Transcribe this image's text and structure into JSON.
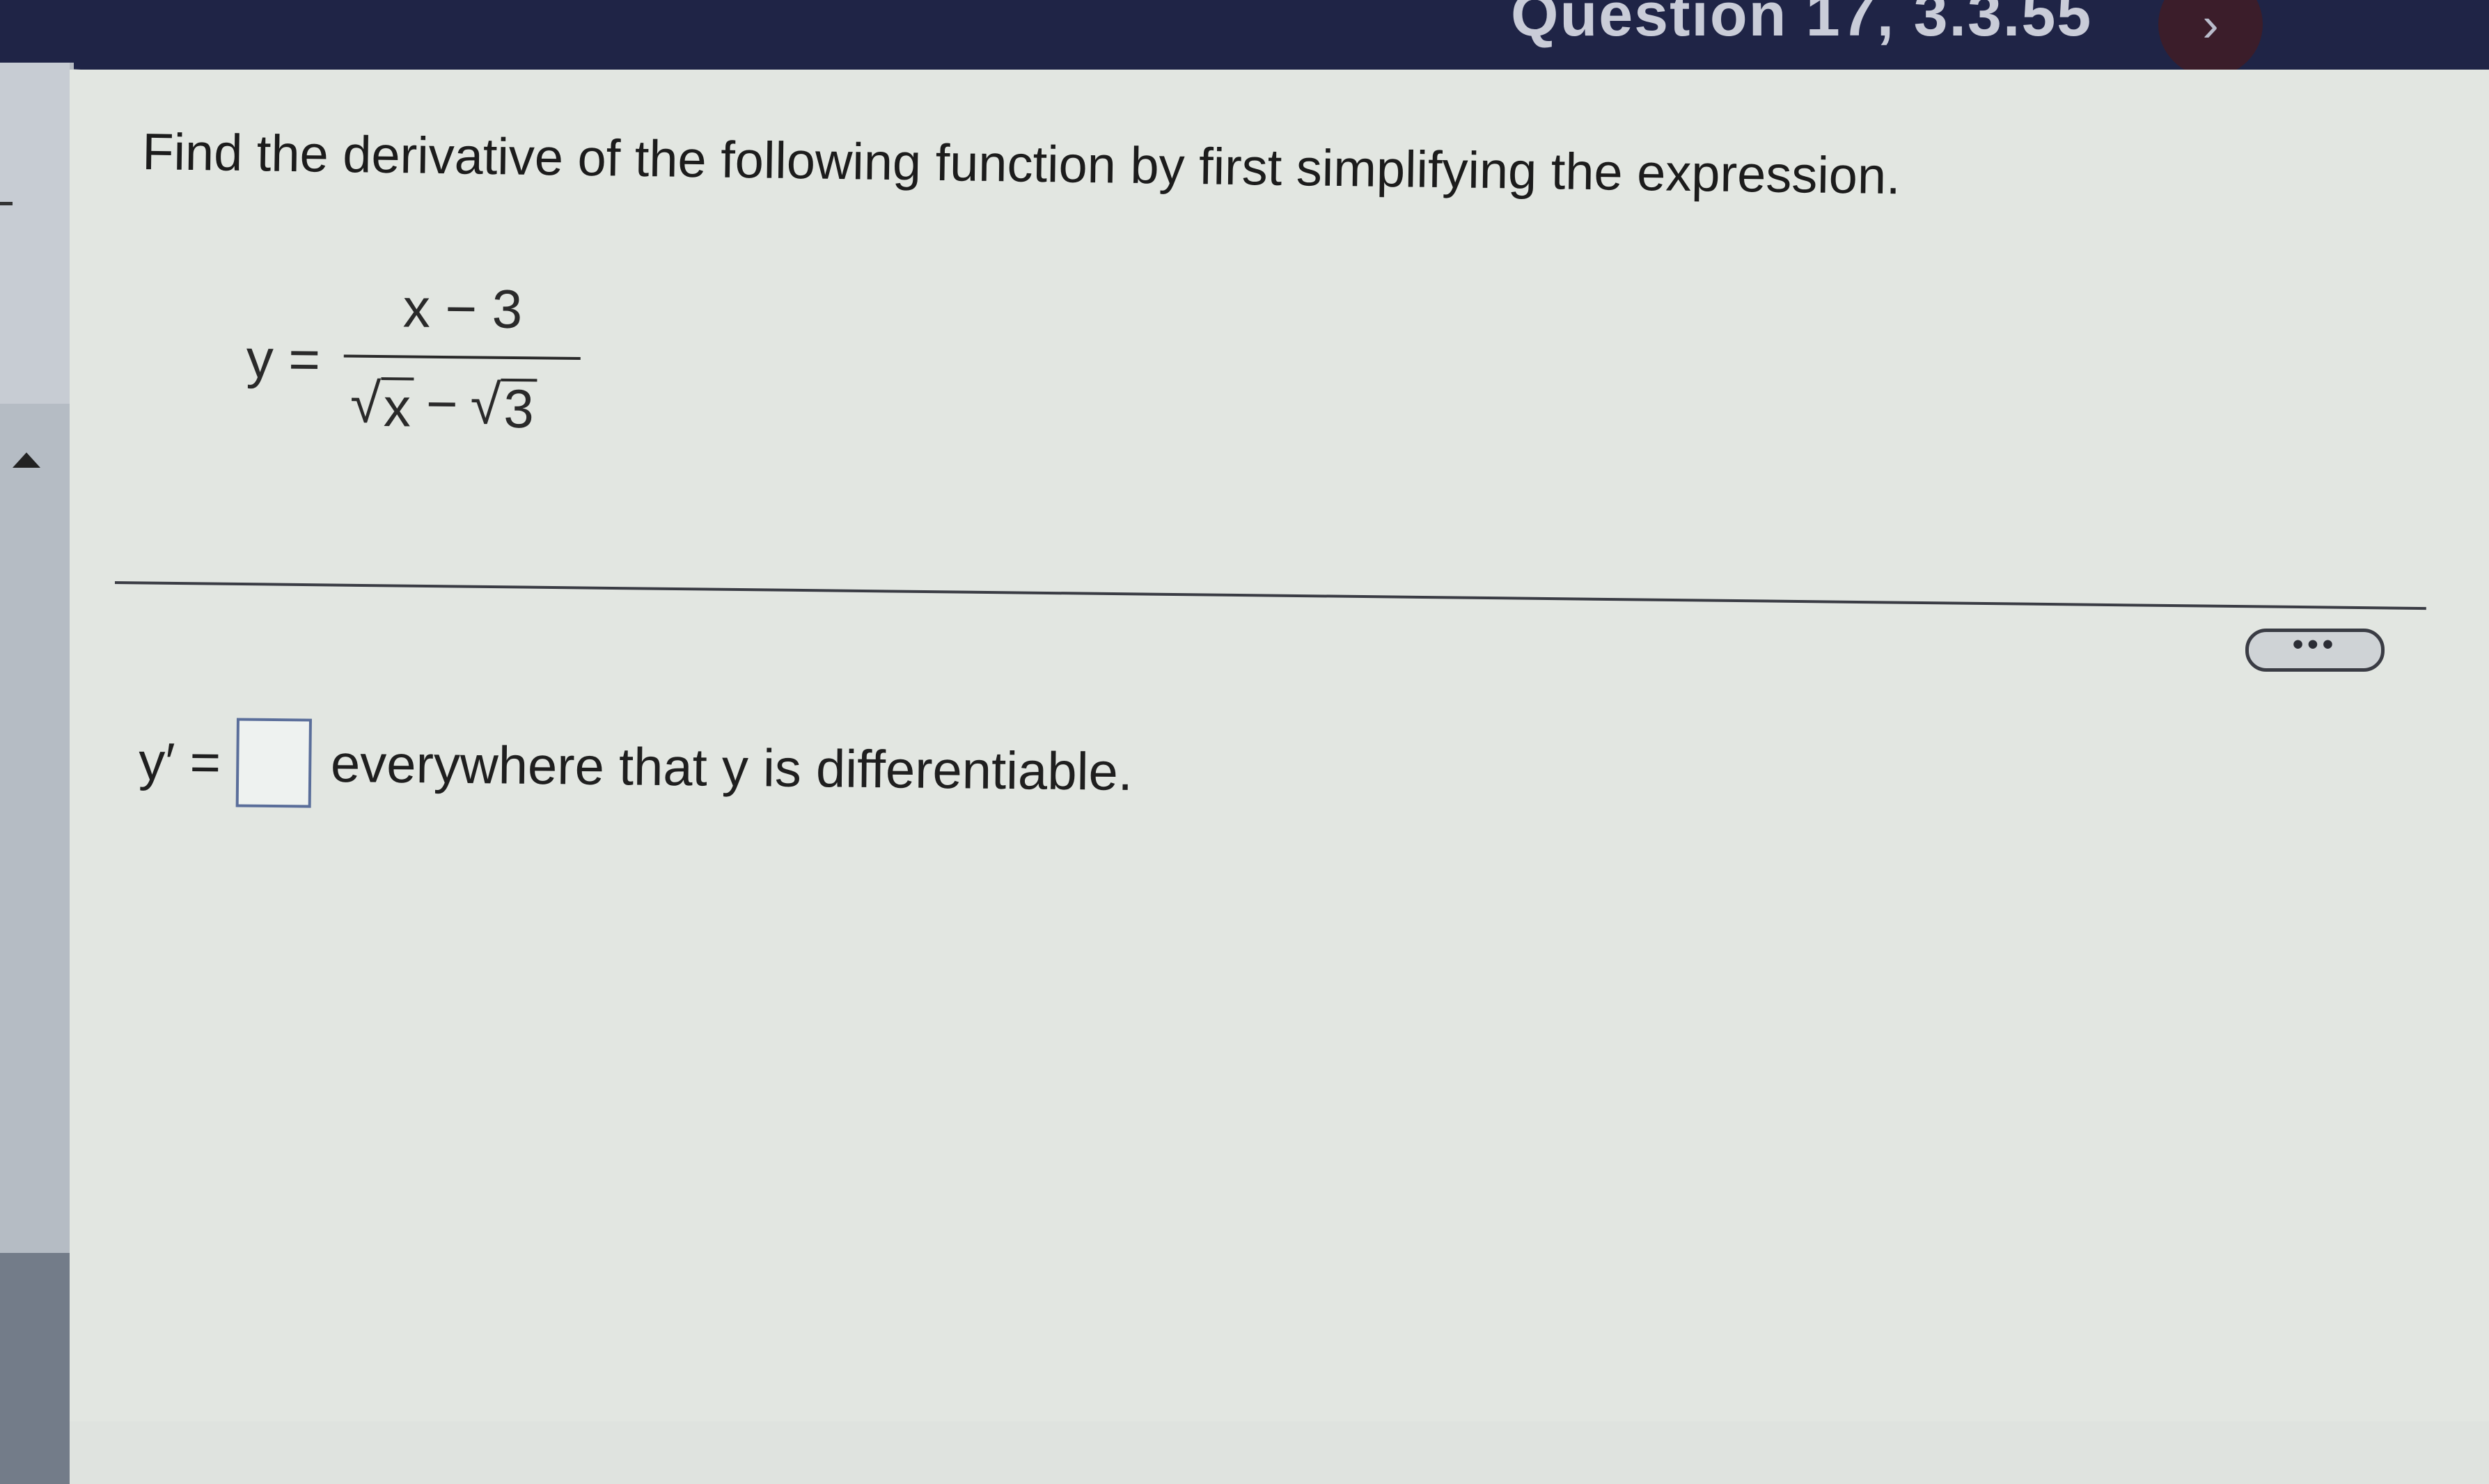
{
  "header": {
    "question_label": "Question 17, 3.3.55",
    "next_icon": "chevron-right-icon",
    "next_symbol": "›"
  },
  "problem": {
    "instruction": "Find the derivative of the following function by first simplifying the expression.",
    "lhs": "y =",
    "numerator": "x − 3",
    "denominator": {
      "radicand_1": "x",
      "operator": "−",
      "radicand_2": "3"
    },
    "radical_symbol": "√"
  },
  "more_button_label": "•••",
  "answer": {
    "lhs": "y′ =",
    "input_value": "",
    "suffix": "everywhere that y is differentiable."
  },
  "colors": {
    "header": "#1f2446",
    "content_background": "#e2e6e1",
    "answer_box_border": "#5a6e9a"
  }
}
